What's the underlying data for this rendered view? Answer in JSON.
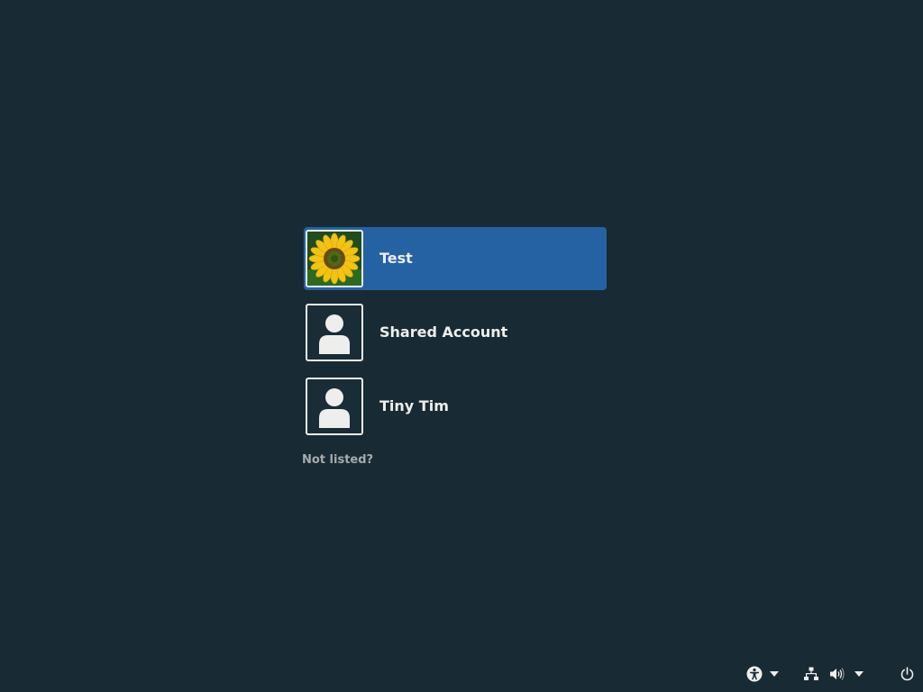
{
  "users": [
    {
      "name": "Test",
      "selected": true,
      "avatar": "sunflower-photo"
    },
    {
      "name": "Shared Account",
      "selected": false,
      "avatar": "generic-user-icon"
    },
    {
      "name": "Tiny Tim",
      "selected": false,
      "avatar": "generic-user-icon"
    }
  ],
  "not_listed_label": "Not listed?",
  "panel": {
    "icons": [
      "accessibility-icon",
      "chevron-down-icon",
      "network-icon",
      "volume-icon",
      "chevron-down-icon",
      "power-icon"
    ]
  },
  "colors": {
    "background": "#182a33",
    "selection": "#2562a3",
    "text": "#eeeeec",
    "muted_text": "#a6abad"
  }
}
